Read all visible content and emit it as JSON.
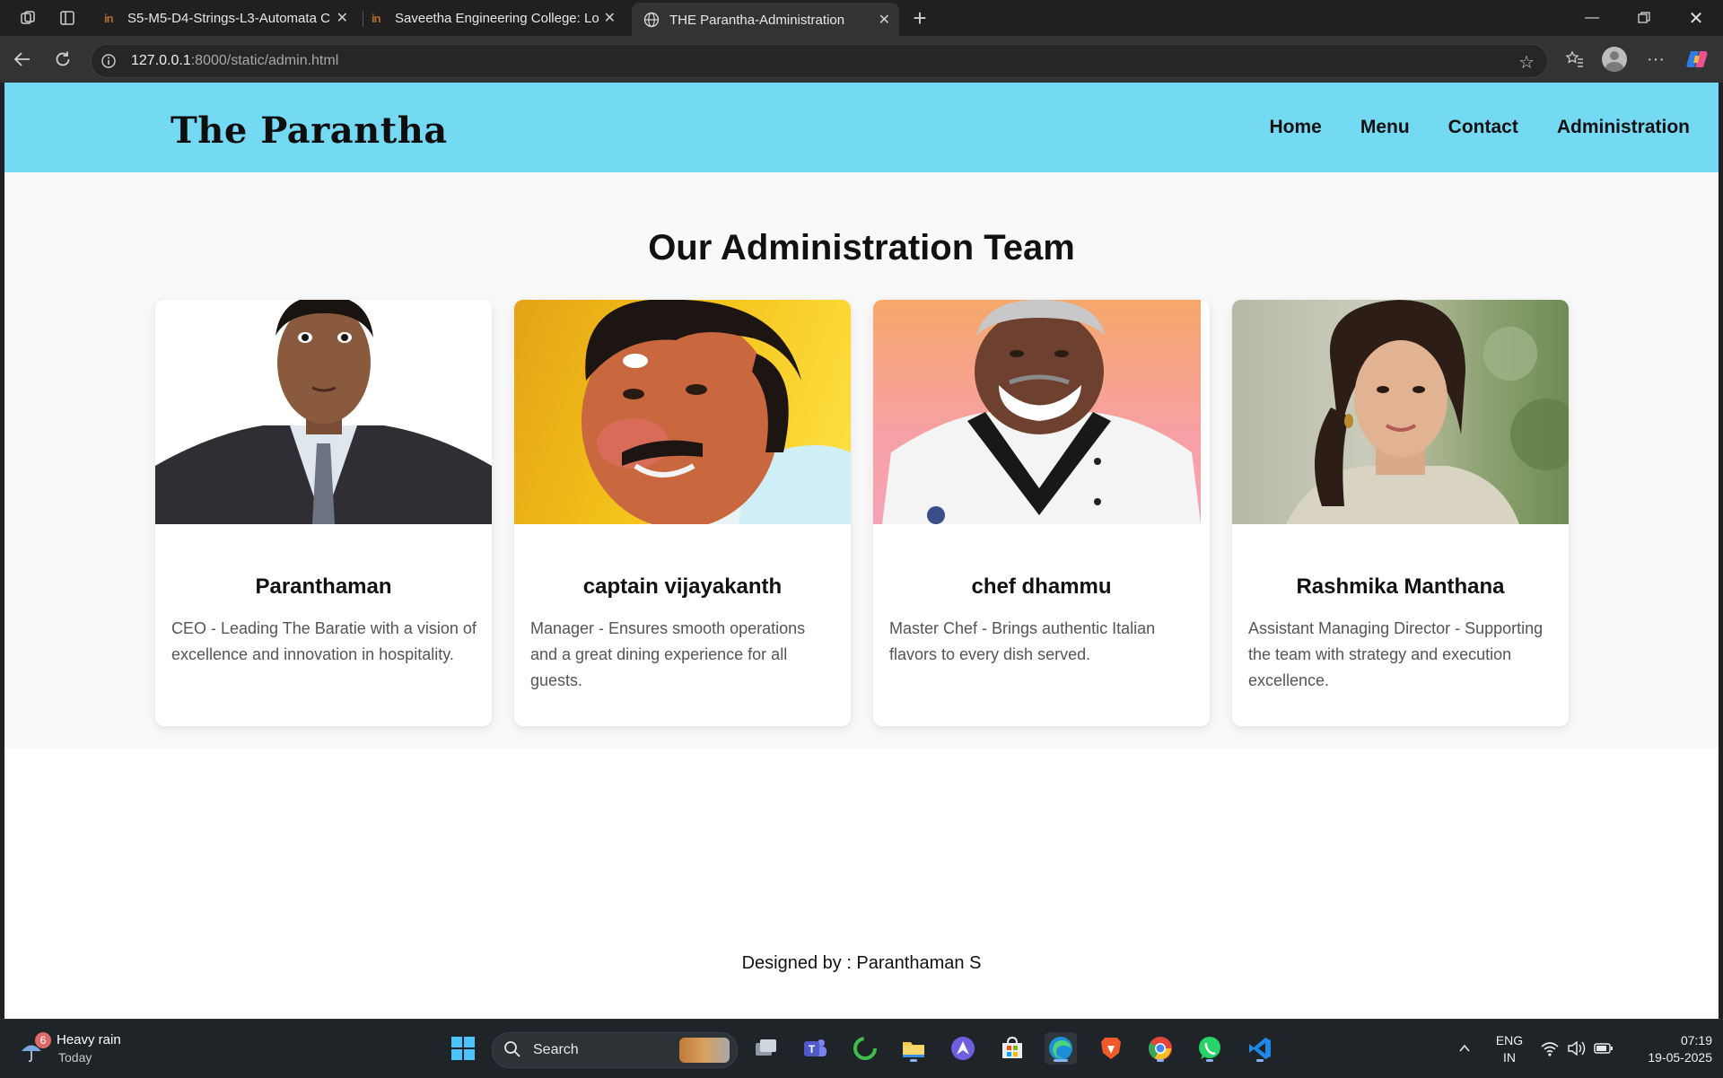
{
  "browser": {
    "tabs": [
      {
        "title": "S5-M5-D4-Strings-L3-Automata C",
        "favicon": "in",
        "active": false
      },
      {
        "title": "Saveetha Engineering College: Lo",
        "favicon": "in",
        "active": false
      },
      {
        "title": "THE Parantha-Administration",
        "favicon": "globe-icon",
        "active": true
      }
    ],
    "address": {
      "host": "127.0.0.1",
      "path": ":8000/static/admin.html"
    }
  },
  "site": {
    "brand": "The Parantha",
    "nav": [
      "Home",
      "Menu",
      "Contact",
      "Administration"
    ],
    "section_title": "Our Administration Team",
    "team": [
      {
        "name": "Paranthaman",
        "desc": "CEO - Leading The Baratie with a vision of excellence and innovation in hospitality."
      },
      {
        "name": "captain vijayakanth",
        "desc": "Manager - Ensures smooth operations and a great dining experience for all guests."
      },
      {
        "name": "chef dhammu",
        "desc": "Master Chef - Brings authentic Italian flavors to every dish served."
      },
      {
        "name": "Rashmika Manthana",
        "desc": "Assistant Managing Director - Supporting the team with strategy and execution excellence."
      }
    ],
    "footer": "Designed by : Paranthaman S"
  },
  "taskbar": {
    "weather": {
      "badge": "6",
      "condition": "Heavy rain",
      "when": "Today"
    },
    "search_placeholder": "Search",
    "lang": {
      "line1": "ENG",
      "line2": "IN"
    },
    "clock": {
      "time": "07:19",
      "date": "19-05-2025"
    }
  }
}
